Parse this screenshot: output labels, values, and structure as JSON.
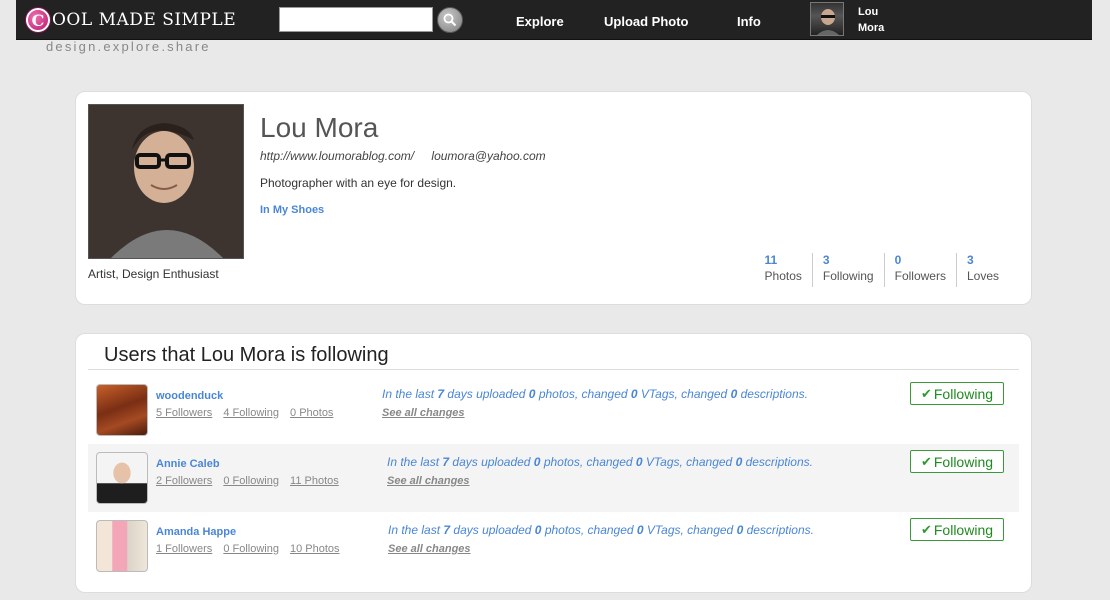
{
  "app": {
    "logo_letter": "C",
    "logo_text": "OOL MADE SIMPLE",
    "tagline": "design.explore.share",
    "search": {
      "value": "",
      "placeholder": ""
    },
    "nav": {
      "explore": "Explore",
      "upload": "Upload Photo",
      "info": "Info"
    },
    "current_user": {
      "first": "Lou",
      "last": "Mora"
    }
  },
  "profile": {
    "name": "Lou Mora",
    "website": "http://www.loumorablog.com/",
    "email": "loumora@yahoo.com",
    "bio": "Photographer with an eye for design.",
    "collection": "In My Shoes",
    "roles": "Artist, Design Enthusiast",
    "stats": [
      {
        "num": "11",
        "label": "Photos"
      },
      {
        "num": "3",
        "label": "Following"
      },
      {
        "num": "0",
        "label": "Followers"
      },
      {
        "num": "3",
        "label": "Loves"
      }
    ]
  },
  "following": {
    "title": "Users that Lou Mora is following",
    "users": [
      {
        "name": "woodenduck",
        "followers": "5 Followers",
        "following": "4 Following",
        "photos": "0 Photos",
        "act_a": "In the last ",
        "days": "7",
        "act_b": " days uploaded ",
        "photos_n": "0",
        "act_c": " photos, changed ",
        "vtags_n": "0",
        "act_d": " VTags, changed ",
        "desc_n": "0",
        "act_e": " descriptions.",
        "see": "See all changes",
        "button": "Following"
      },
      {
        "name": "Annie Caleb",
        "followers": "2 Followers",
        "following": "0 Following",
        "photos": "11 Photos",
        "act_a": "In the last ",
        "days": "7",
        "act_b": " days uploaded ",
        "photos_n": "0",
        "act_c": " photos, changed ",
        "vtags_n": "0",
        "act_d": " VTags, changed ",
        "desc_n": "0",
        "act_e": " descriptions.",
        "see": "See all changes",
        "button": "Following"
      },
      {
        "name": "Amanda Happe",
        "followers": "1 Followers",
        "following": "0 Following",
        "photos": "10 Photos",
        "act_a": "In the last ",
        "days": "7",
        "act_b": " days uploaded ",
        "photos_n": "0",
        "act_c": " photos, changed ",
        "vtags_n": "0",
        "act_d": " VTags, changed ",
        "desc_n": "0",
        "act_e": " descriptions.",
        "see": "See all changes",
        "button": "Following"
      }
    ]
  },
  "colors": {
    "accent": "#4a86d6",
    "follow_green": "#1f8a1f",
    "topbar": "#222222",
    "brand_pink": "#c2207a"
  },
  "icons": {
    "search": "search-icon",
    "check": "checkmark-icon"
  }
}
